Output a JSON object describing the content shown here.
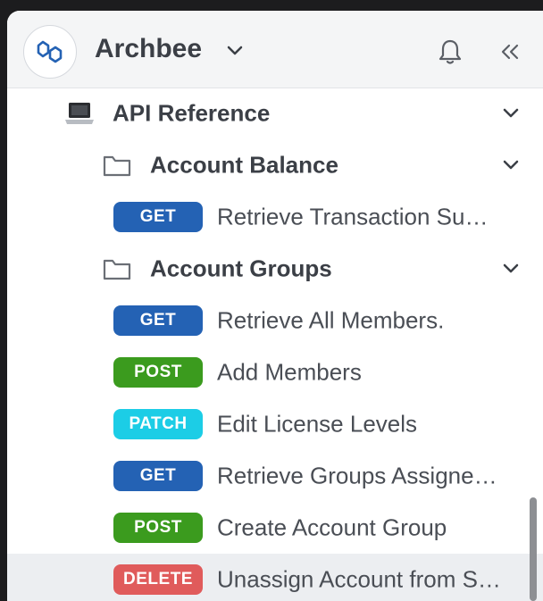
{
  "workspace": {
    "name": "Archbee"
  },
  "colors": {
    "GET": "#2462b4",
    "POST": "#3b9b1e",
    "PATCH": "#1ccde6",
    "DELETE": "#e05b5b"
  },
  "tree": {
    "api_reference": {
      "label": "API Reference",
      "icon": "laptop-icon"
    },
    "account_balance": {
      "label": "Account Balance",
      "icon": "folder-icon",
      "items": [
        {
          "method": "GET",
          "label": "Retrieve Transaction Su…"
        }
      ]
    },
    "account_groups": {
      "label": "Account Groups",
      "icon": "folder-icon",
      "items": [
        {
          "method": "GET",
          "label": "Retrieve All Members."
        },
        {
          "method": "POST",
          "label": "Add Members"
        },
        {
          "method": "PATCH",
          "label": "Edit License Levels"
        },
        {
          "method": "GET",
          "label": "Retrieve Groups Assigne…"
        },
        {
          "method": "POST",
          "label": "Create Account Group"
        },
        {
          "method": "DELETE",
          "label": "Unassign Account from S…"
        }
      ]
    }
  }
}
